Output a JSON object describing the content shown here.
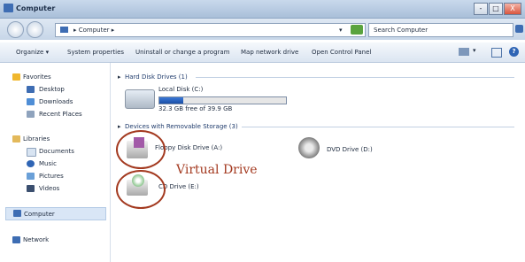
{
  "window": {
    "title": "Computer",
    "minimize": "-",
    "maximize": "□",
    "close": "X"
  },
  "address": {
    "path": "Computer",
    "search_placeholder": "Search Computer"
  },
  "toolbar": {
    "organize": "Organize",
    "system_properties": "System properties",
    "uninstall": "Uninstall or change a program",
    "map_drive": "Map network drive",
    "control_panel": "Open Control Panel"
  },
  "sidebar": {
    "favorites": "Favorites",
    "desktop": "Desktop",
    "downloads": "Downloads",
    "recent": "Recent Places",
    "libraries": "Libraries",
    "documents": "Documents",
    "music": "Music",
    "pictures": "Pictures",
    "videos": "Videos",
    "computer": "Computer",
    "network": "Network"
  },
  "hard_disk": {
    "header": "Hard Disk Drives (1)",
    "name": "Local Disk (C:)",
    "free_text": "32.3 GB free of 39.9 GB",
    "used_fraction": 0.19
  },
  "removable": {
    "header": "Devices with Removable Storage (3)",
    "floppy": "Floppy Disk Drive (A:)",
    "dvd": "DVD Drive (D:)",
    "cd": "CD Drive (E:)"
  },
  "annotation": {
    "label": "Virtual Drive",
    "color": "#a3391f"
  }
}
